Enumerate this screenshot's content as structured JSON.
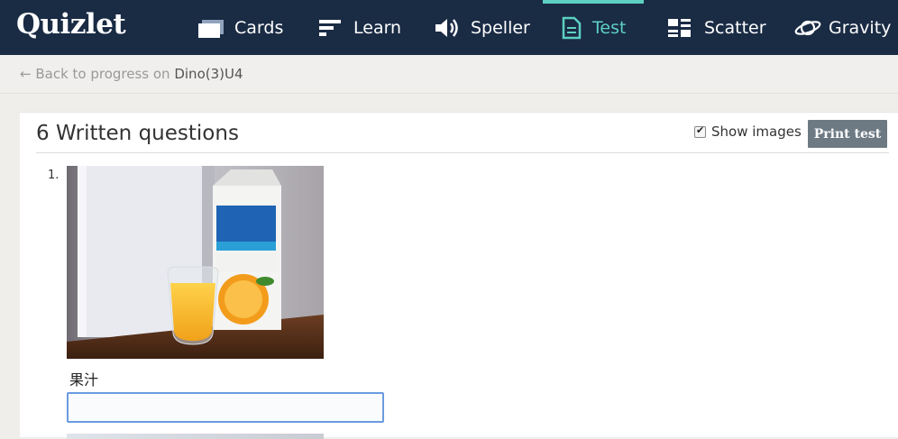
{
  "app": {
    "logo": "Quizlet"
  },
  "nav": {
    "items": [
      {
        "label": "Cards",
        "icon": "cards-icon"
      },
      {
        "label": "Learn",
        "icon": "learn-icon"
      },
      {
        "label": "Speller",
        "icon": "speaker-icon"
      },
      {
        "label": "Test",
        "icon": "test-document-icon",
        "active": true
      },
      {
        "label": "Scatter",
        "icon": "scatter-icon"
      },
      {
        "label": "Gravity",
        "icon": "planet-icon"
      }
    ]
  },
  "breadcrumb": {
    "prefix": "← Back to progress on",
    "set_name": "Dino(3)U4"
  },
  "test": {
    "section_title": "6 Written questions",
    "show_images_label": "Show images",
    "show_images_checked": true,
    "print_label": "Print test",
    "questions": [
      {
        "number": "1.",
        "term": "果汁",
        "answer_value": ""
      }
    ]
  },
  "colors": {
    "topbar": "#1a2b44",
    "active_accent": "#5dd0c2",
    "print_button": "#6d7a84",
    "input_focus": "#6a9be0"
  }
}
